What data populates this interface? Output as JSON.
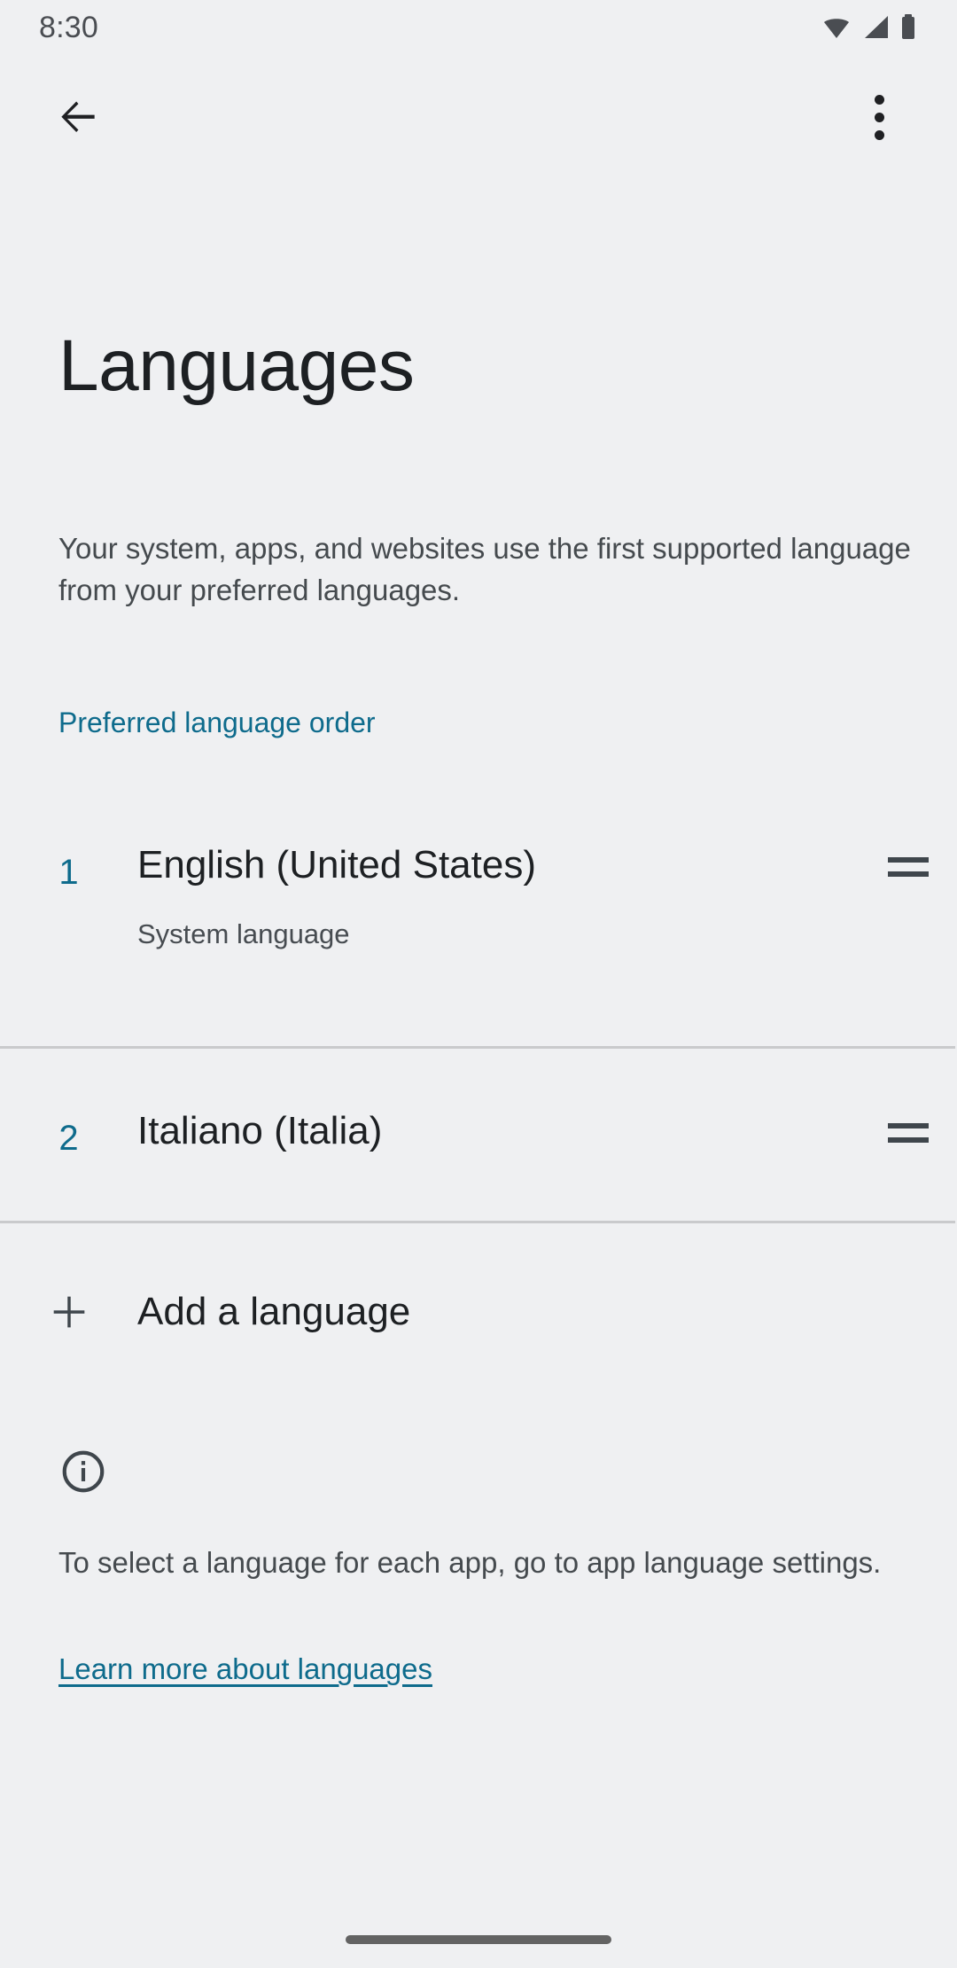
{
  "status_bar": {
    "time": "8:30",
    "icons": [
      "wifi-icon",
      "cell-signal-icon",
      "battery-icon"
    ]
  },
  "app_bar": {
    "back_icon": "back-arrow-icon",
    "overflow_icon": "more-vert-icon"
  },
  "header": {
    "title": "Languages",
    "description": "Your system, apps, and websites use the first supported language from your preferred languages."
  },
  "section": {
    "header": "Preferred language order"
  },
  "languages": [
    {
      "index": "1",
      "name": "English (United States)",
      "subtitle": "System language",
      "drag_icon": "drag-handle-icon"
    },
    {
      "index": "2",
      "name": "Italiano (Italia)",
      "subtitle": "",
      "drag_icon": "drag-handle-icon"
    }
  ],
  "add_language": {
    "label": "Add a language",
    "icon": "plus-icon"
  },
  "footer": {
    "icon": "info-circle-icon",
    "text": "To select a language for each app, go to app language settings.",
    "link": "Learn more about languages"
  },
  "colors": {
    "background": "#eff0f2",
    "accent": "#0e6b8c",
    "primary_text": "#1d2023",
    "secondary_text": "#454a4e",
    "divider": "#c9cacc",
    "icon": "#3f464c",
    "nav_bar": "#636363"
  }
}
